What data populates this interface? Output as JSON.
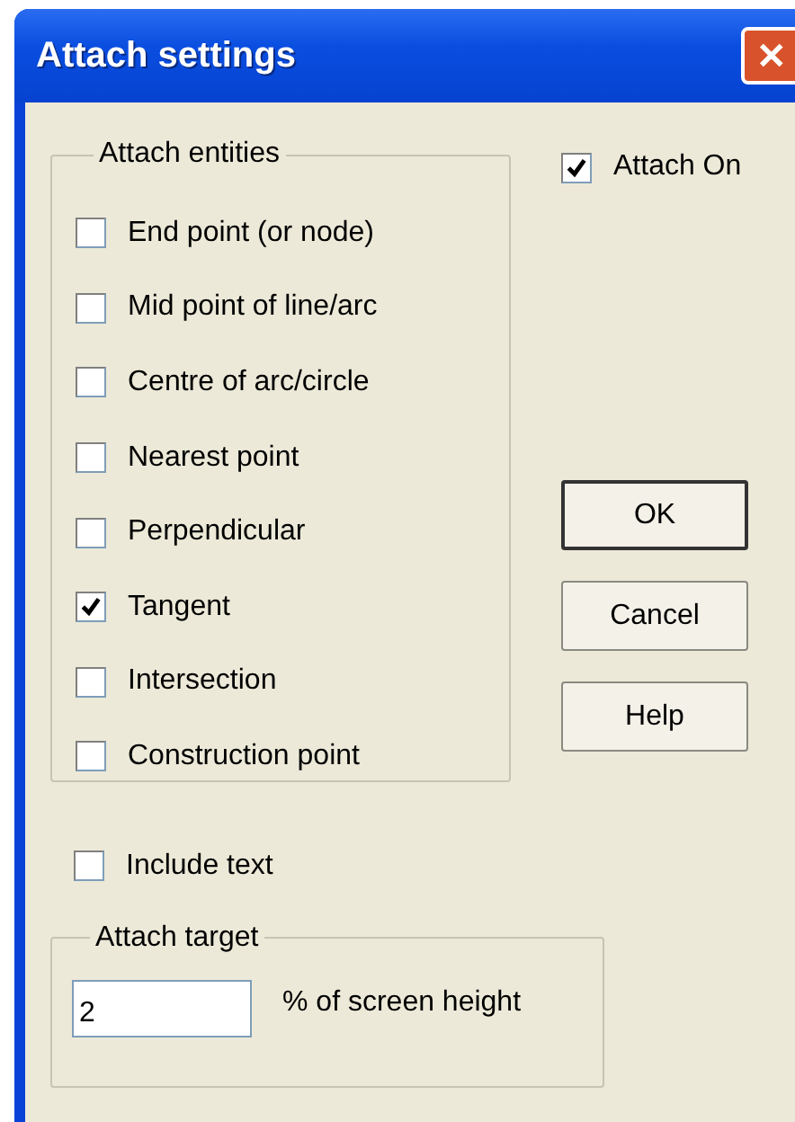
{
  "window": {
    "title": "Attach settings",
    "close": "✕"
  },
  "attach_entities": {
    "title": "Attach entities",
    "items": [
      {
        "label": "End point (or node)",
        "checked": false
      },
      {
        "label": "Mid point of line/arc",
        "checked": false
      },
      {
        "label": "Centre of arc/circle",
        "checked": false
      },
      {
        "label": "Nearest point",
        "checked": false
      },
      {
        "label": "Perpendicular",
        "checked": false
      },
      {
        "label": "Tangent",
        "checked": true
      },
      {
        "label": "Intersection",
        "checked": false
      },
      {
        "label": "Construction point",
        "checked": false
      }
    ]
  },
  "attach_on": {
    "label": "Attach On",
    "checked": true
  },
  "buttons": [
    "OK",
    "Cancel",
    "Help"
  ],
  "include_text": {
    "label": "Include text",
    "checked": false
  },
  "attach_target": {
    "title": "Attach target",
    "value": "2",
    "unit": "% of screen height"
  }
}
